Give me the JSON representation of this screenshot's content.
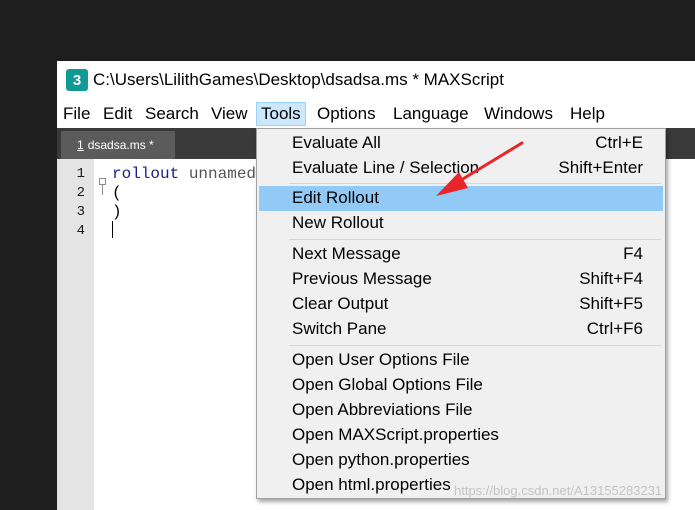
{
  "window": {
    "app_icon_label": "3",
    "title": "C:\\Users\\LilithGames\\Desktop\\dsadsa.ms * MAXScript"
  },
  "menubar": {
    "items": [
      "File",
      "Edit",
      "Search",
      "View",
      "Tools",
      "Options",
      "Language",
      "Windows",
      "Help"
    ],
    "active": "Tools"
  },
  "tabs": [
    {
      "number": "1",
      "label": "dsadsa.ms *"
    }
  ],
  "editor": {
    "line_numbers": [
      "1",
      "2",
      "3",
      "4"
    ],
    "code": {
      "line1_keyword": "rollout",
      "line1_rest": " unnamed",
      "line2": "(",
      "line3": ")",
      "line4": ""
    }
  },
  "tools_menu": {
    "groups": [
      [
        {
          "label": "Evaluate All",
          "shortcut": "Ctrl+E"
        },
        {
          "label": "Evaluate Line / Selection",
          "shortcut": "Shift+Enter"
        }
      ],
      [
        {
          "label": "Edit Rollout",
          "shortcut": "",
          "highlighted": true
        },
        {
          "label": "New Rollout",
          "shortcut": ""
        }
      ],
      [
        {
          "label": "Next Message",
          "shortcut": "F4"
        },
        {
          "label": "Previous Message",
          "shortcut": "Shift+F4"
        },
        {
          "label": "Clear Output",
          "shortcut": "Shift+F5"
        },
        {
          "label": "Switch Pane",
          "shortcut": "Ctrl+F6"
        }
      ],
      [
        {
          "label": "Open User Options File",
          "shortcut": ""
        },
        {
          "label": "Open Global Options File",
          "shortcut": ""
        },
        {
          "label": "Open Abbreviations File",
          "shortcut": ""
        },
        {
          "label": "Open MAXScript.properties",
          "shortcut": ""
        },
        {
          "label": "Open python.properties",
          "shortcut": ""
        },
        {
          "label": "Open html.properties",
          "shortcut": ""
        }
      ]
    ]
  },
  "colors": {
    "highlight": "#91c9f7",
    "arrow": "#e8262a",
    "menu_active": "#cce8ff"
  },
  "watermark": "https://blog.csdn.net/A13155283231"
}
